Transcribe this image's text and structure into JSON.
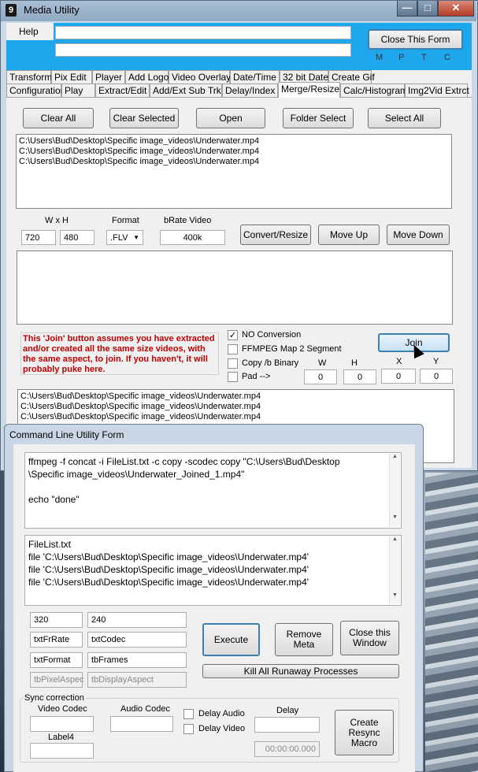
{
  "window": {
    "title": "Media Utility",
    "icon_label": "9",
    "minimize": "—",
    "maximize": "□",
    "close": "✕"
  },
  "menu": {
    "help": "Help"
  },
  "header": {
    "close_form": "Close This Form",
    "mptc": [
      "M",
      "P",
      "T",
      "C"
    ]
  },
  "tabs_row1": [
    "Transform",
    "Pix Edit",
    "Player",
    "Add Logo",
    "Video Overlay",
    "Date/Time",
    "32 bit Date",
    "Create Gif"
  ],
  "tabs_row2": [
    "Configuration",
    "Play",
    "Extract/Edit",
    "Add/Ext Sub Trk",
    "Delay/Index",
    "Merge/Resize",
    "Calc/Histogram",
    "Img2Vid Extrct"
  ],
  "toolbar": {
    "clear_all": "Clear All",
    "clear_selected": "Clear Selected",
    "open": "Open",
    "folder_select": "Folder Select",
    "select_all": "Select All"
  },
  "file_list": [
    "C:\\Users\\Bud\\Desktop\\Specific image_videos\\Underwater.mp4",
    "C:\\Users\\Bud\\Desktop\\Specific image_videos\\Underwater.mp4",
    "C:\\Users\\Bud\\Desktop\\Specific image_videos\\Underwater.mp4"
  ],
  "resize": {
    "wxh_label": "W x H",
    "width": "720",
    "height": "480",
    "format_label": "Format",
    "format_value": ".FLV",
    "brate_label": "bRate Video",
    "brate_value": "400k",
    "convert": "Convert/Resize",
    "move_up": "Move Up",
    "move_down": "Move Down"
  },
  "join": {
    "warning": "This 'Join' button assumes you have extracted  and/or created all the same size videos, with the same aspect,  to join.  If you haven't, it will probably puke here.",
    "no_conversion": "NO Conversion",
    "no_conversion_checked": true,
    "ffmpeg_map": "FFMPEG Map 2 Segment",
    "copy_binary": "Copy /b Binary",
    "pad": "Pad  -->",
    "join_button": "Join",
    "w_label": "W",
    "h_label": "H",
    "x_label": "X",
    "y_label": "Y",
    "w": "0",
    "h": "0",
    "x": "0",
    "y": "0"
  },
  "join_list": [
    "C:\\Users\\Bud\\Desktop\\Specific image_videos\\Underwater.mp4",
    "C:\\Users\\Bud\\Desktop\\Specific image_videos\\Underwater.mp4",
    "C:\\Users\\Bud\\Desktop\\Specific image_videos\\Underwater.mp4"
  ],
  "cmd": {
    "title": "Command Line Utility Form",
    "command": "ffmpeg -f concat -i FileList.txt -c copy -scodec copy \"C:\\Users\\Bud\\Desktop\n\\Specific image_videos\\Underwater_Joined_1.mp4\"\n\necho \"done\"",
    "filelist": "FileList.txt\nfile 'C:\\Users\\Bud\\Desktop\\Specific image_videos\\Underwater.mp4'\nfile 'C:\\Users\\Bud\\Desktop\\Specific image_videos\\Underwater.mp4'\nfile 'C:\\Users\\Bud\\Desktop\\Specific image_videos\\Underwater.mp4'",
    "w": "320",
    "h": "240",
    "frrate": "txtFrRate",
    "codec": "txtCodec",
    "format": "txtFormat",
    "frames": "tbFrames",
    "pixel_aspect": "tbPixelAspec",
    "display_aspect": "tbDisplayAspect",
    "execute": "Execute",
    "remove_meta": "Remove\nMeta",
    "close_window": "Close this\nWindow",
    "kill": "Kill All Runaway Processes",
    "sync_title": "Sync correction",
    "video_codec": "Video Codec",
    "audio_codec": "Audio Codec",
    "delay_audio": "Delay Audio",
    "delay_video": "Delay Video",
    "delay_label": "Delay",
    "label4": "Label4",
    "timecode": "00:00:00.000",
    "create_macro": "Create\nResync\nMacro"
  }
}
